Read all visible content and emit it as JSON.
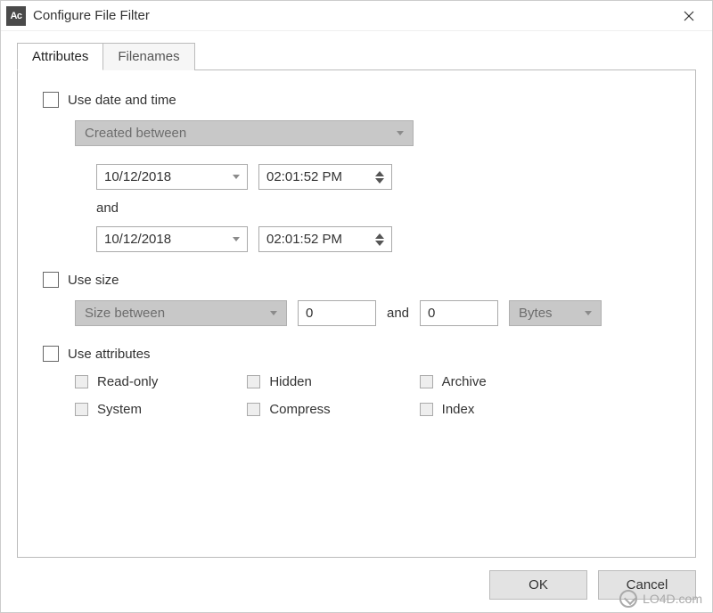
{
  "window": {
    "title": "Configure File Filter",
    "app_icon_text": "Ac"
  },
  "tabs": [
    {
      "label": "Attributes",
      "active": true
    },
    {
      "label": "Filenames",
      "active": false
    }
  ],
  "date_section": {
    "checkbox_label": "Use date and time",
    "mode_label": "Created between",
    "from_date": "10/12/2018",
    "from_time": "02:01:52  PM",
    "and_label": "and",
    "to_date": "10/12/2018",
    "to_time": "02:01:52  PM"
  },
  "size_section": {
    "checkbox_label": "Use size",
    "mode_label": "Size between",
    "from_value": "0",
    "and_label": "and",
    "to_value": "0",
    "unit_label": "Bytes"
  },
  "attr_section": {
    "checkbox_label": "Use attributes",
    "items": [
      "Read-only",
      "Hidden",
      "Archive",
      "System",
      "Compress",
      "Index"
    ]
  },
  "buttons": {
    "ok": "OK",
    "cancel": "Cancel"
  },
  "watermark": "LO4D.com"
}
